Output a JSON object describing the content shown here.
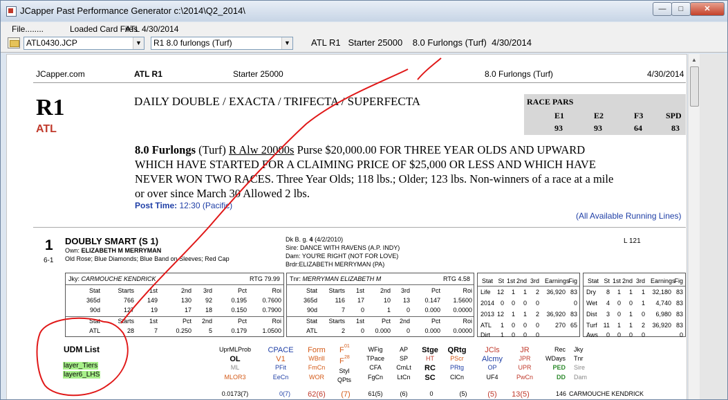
{
  "window": {
    "title": "JCapper Past Performance Generator c:\\2014\\Q2_2014\\"
  },
  "menu": {
    "items": [
      "File........",
      "Loaded Card Files",
      "ATL 4/30/2014"
    ]
  },
  "toolbar": {
    "file_select": "ATL0430.JCP",
    "race_select": "R1  8.0 furlongs (Turf)",
    "info": [
      "ATL R1",
      "Starter 25000",
      "8.0 Furlongs (Turf)",
      "4/30/2014"
    ]
  },
  "sheet": {
    "header": {
      "site": "JCapper.com",
      "race": "ATL R1",
      "class": "Starter 25000",
      "distance": "8.0 Furlongs (Turf)",
      "date": "4/30/2014"
    },
    "race_number": "R1",
    "track": "ATL",
    "wagers": "DAILY DOUBLE / EXACTA / TRIFECTA / SUPERFECTA",
    "race_pars": {
      "title": "RACE PARS",
      "labels": [
        "E1",
        "E2",
        "F3",
        "SPD"
      ],
      "values": [
        "93",
        "93",
        "64",
        "83"
      ]
    },
    "conditions": {
      "furlongs": "8.0 Furlongs",
      "surface": "(Turf)",
      "race_type": "R Alw 20000s",
      "lines": [
        "Purse $20,000.00 FOR THREE YEAR OLDS AND UPWARD",
        "WHICH HAVE STARTED FOR A CLAIMING PRICE OF $25,000 OR LESS AND WHICH HAVE",
        "NEVER WON TWO RACES. Three Year Olds; 118 lbs.; Older; 123 lbs. Non-winners of a race at a mile",
        "or over since March 30 Allowed 2 lbs."
      ],
      "post_time_label": "Post Time:",
      "post_time": "12:30 (Pacific)"
    },
    "all_lines_link": "(All Available Running Lines)",
    "horse": {
      "number": "1",
      "odds": "6-1",
      "name": "DOUBLY SMART  (S 1)",
      "owner_label": "Own:",
      "owner": "ELIZABETH M MERRYMAN",
      "silks": "Old Rose; Blue Diamonds; Blue Band on Sleeves; Red Cap",
      "desc_prefix": "Dk B. g.",
      "age": "4",
      "birth": "(4/2/2010)",
      "sire": "Sire: DANCE WITH RAVENS (A.P. INDY)",
      "dam": "Dam: YOU'RE RIGHT (NOT FOR LOVE)",
      "breeder": "Brdr:ELIZABETH MERRYMAN (PA)",
      "weight": "L 121"
    },
    "jockey": {
      "label": "Jky:",
      "name": "CARMOUCHE KENDRICK",
      "rtg": "RTG 79.99",
      "head": [
        "Stat",
        "Starts",
        "1st",
        "2nd",
        "3rd",
        "Pct",
        "Roi"
      ],
      "rows": [
        [
          "365d",
          "766",
          "149",
          "130",
          "92",
          "0.195",
          "0.7600"
        ],
        [
          "90d",
          "127",
          "19",
          "17",
          "18",
          "0.150",
          "0.7900"
        ]
      ],
      "head2": [
        "Stat",
        "Starts",
        "1st",
        "Pct",
        "2nd",
        "Pct",
        "Roi"
      ],
      "row2": [
        "ATL",
        "28",
        "7",
        "0.250",
        "5",
        "0.179",
        "1.0500"
      ]
    },
    "trainer": {
      "label": "Tnr:",
      "name": "MERRYMAN ELIZABETH M",
      "rtg": "RTG 4.58",
      "head": [
        "Stat",
        "Starts",
        "1st",
        "2nd",
        "3rd",
        "Pct",
        "Roi"
      ],
      "rows": [
        [
          "365d",
          "116",
          "17",
          "10",
          "13",
          "0.147",
          "1.5600"
        ],
        [
          "90d",
          "7",
          "0",
          "1",
          "0",
          "0.000",
          "0.0000"
        ]
      ],
      "head2": [
        "Stat",
        "Starts",
        "1st",
        "Pct",
        "2nd",
        "Pct",
        "Roi"
      ],
      "row2": [
        "ATL",
        "2",
        "0",
        "0.000",
        "0",
        "0.000",
        "0.0000"
      ]
    },
    "lifetime": {
      "head": [
        "Stat",
        "St",
        "1st",
        "2nd",
        "3rd",
        "Earnings",
        "Fig"
      ],
      "rows": [
        [
          "Life",
          "12",
          "1",
          "1",
          "2",
          "36,920",
          "83"
        ],
        [
          "2014",
          "0",
          "0",
          "0",
          "0",
          "",
          "0"
        ],
        [
          "2013",
          "12",
          "1",
          "1",
          "2",
          "36,920",
          "83"
        ],
        [
          "ATL",
          "1",
          "0",
          "0",
          "0",
          "270",
          "65"
        ],
        [
          "Dirt",
          "1",
          "0",
          "0",
          "0",
          "",
          ""
        ]
      ]
    },
    "surface_stats": {
      "head": [
        "Stat",
        "St",
        "1st",
        "2nd",
        "3rd",
        "Earnings",
        "Fig"
      ],
      "rows": [
        [
          "Dry",
          "8",
          "1",
          "1",
          "1",
          "32,180",
          "83"
        ],
        [
          "Wet",
          "4",
          "0",
          "0",
          "1",
          "4,740",
          "83"
        ],
        [
          "Dist",
          "3",
          "0",
          "1",
          "0",
          "6,980",
          "83"
        ],
        [
          "Turf",
          "11",
          "1",
          "1",
          "2",
          "36,920",
          "83"
        ],
        [
          "Aws",
          "0",
          "0",
          "0",
          "0",
          "",
          "0"
        ]
      ]
    },
    "udm": {
      "title": "UDM List",
      "items": [
        "layer_Tiers",
        "layer6_LHS"
      ]
    },
    "factors": {
      "c1": [
        "UprMLProb",
        "OL",
        "ML",
        "MLOR3"
      ],
      "c2": [
        "CPACE",
        "V1",
        "PFit",
        "EeCn"
      ],
      "c3": [
        "Form",
        "WBrill",
        "FmCn",
        "WOR"
      ],
      "c4": [
        "F",
        "01",
        "F",
        "28",
        "Styl",
        "QPts"
      ],
      "c5": [
        "WFig",
        "TPace",
        "CFA",
        "FgCn"
      ],
      "c6": [
        "AP",
        "SP",
        "CmLt",
        "LtCn"
      ],
      "c7": [
        "Stge",
        "HT",
        "RC",
        "SC"
      ],
      "c8": [
        "QRtg",
        "PScr",
        "PRtg",
        "ClCn"
      ],
      "c9": [
        "JCls",
        "Alcmy",
        "OP",
        "UF4"
      ],
      "c10": [
        "JR",
        "JPR",
        "UPR",
        "PwCn"
      ],
      "c11": [
        "Rec",
        "WDays",
        "PED",
        "DD"
      ],
      "c12": [
        "Jky",
        "Tnr",
        "Sire",
        "Dam"
      ]
    },
    "values_row": [
      "0.0173(7)",
      "0(7)",
      "62(6)",
      "(7)",
      "61(5)",
      "(6)",
      "0",
      "(5)",
      "(5)",
      "13(5)",
      "146",
      "CARMOUCHE KENDRICK"
    ]
  }
}
